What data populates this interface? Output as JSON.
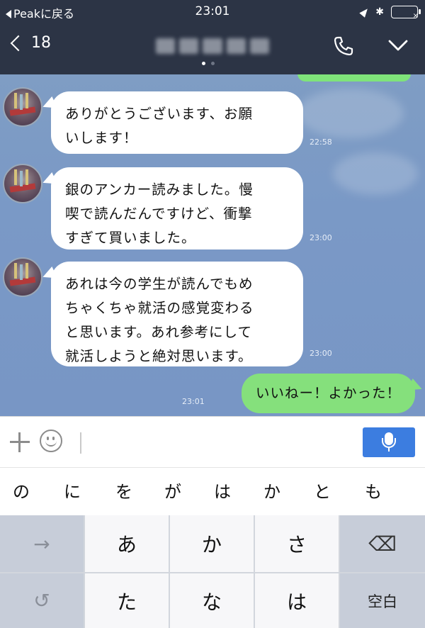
{
  "status_bar": {
    "back_app": "Peakに戻る",
    "time": "23:01",
    "battery_mark": "×"
  },
  "header": {
    "back_count": "18",
    "title_blurred": true
  },
  "messages": [
    {
      "from": "other",
      "text_lines": [
        "ありがとうございます、お願",
        "いします！"
      ],
      "time": "22:58"
    },
    {
      "from": "other",
      "text_lines": [
        "銀のアンカー読みました。慢",
        "喫で読んだんですけど、衝撃",
        "すぎて買いました。"
      ],
      "time": "23:00"
    },
    {
      "from": "other",
      "text_lines": [
        "あれは今の学生が読んでもめ",
        "ちゃくちゃ就活の感覚変わる",
        "と思います。あれ参考にして",
        "就活しようと絶対思います。"
      ],
      "time": "23:00"
    },
    {
      "from": "me",
      "text": "いいねー！よかった！",
      "time": "23:01"
    }
  ],
  "input": {
    "placeholder": "",
    "value": ""
  },
  "suggestions": [
    "の",
    "に",
    "を",
    "が",
    "は",
    "か",
    "と",
    "も"
  ],
  "keyboard": {
    "row1": [
      "→",
      "あ",
      "か",
      "さ",
      "⌫"
    ],
    "row2": [
      "↺",
      "た",
      "な",
      "は",
      "空白"
    ]
  },
  "colors": {
    "header_bg": "#2c3445",
    "chat_bg": "#7a99c6",
    "my_bubble": "#85e07c",
    "other_bubble": "#ffffff",
    "mic_button": "#3c7de0"
  },
  "icons": {
    "back": "chevron-left-icon",
    "call": "phone-icon",
    "menu": "chevron-down-icon",
    "add": "plus-icon",
    "emoji": "smile-icon",
    "voice": "microphone-icon",
    "delete": "backspace-icon",
    "undo": "undo-icon",
    "next": "arrow-right-icon"
  }
}
